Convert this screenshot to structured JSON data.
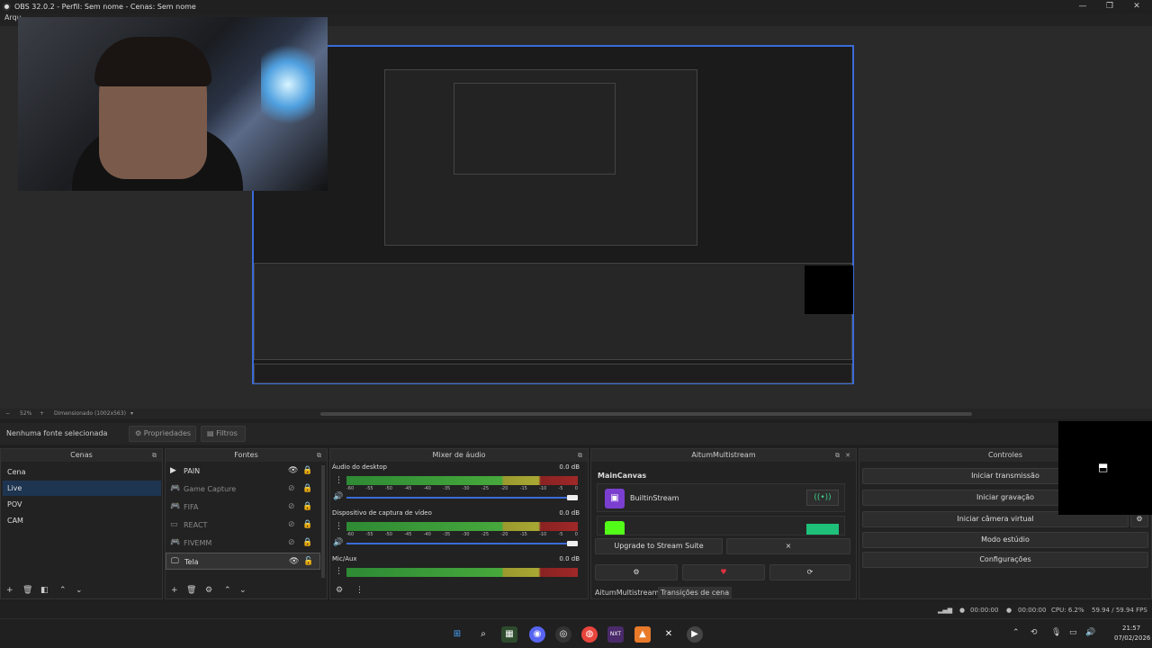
{
  "window": {
    "title": "OBS 32.0.2 - Perfil: Sem nome - Cenas: Sem nome",
    "menu_partial": "Arqu"
  },
  "zoom": {
    "minus": "−",
    "level": "52%",
    "plus": "+",
    "mode": "Dimensionado (1002x563)"
  },
  "source_toolbar": {
    "none_selected": "Nenhuma fonte selecionada",
    "properties": "Propriedades",
    "filters": "Filtros"
  },
  "scenes": {
    "title": "Cenas",
    "items": [
      "Cena",
      "Live",
      "POV",
      "CAM"
    ],
    "selected": 1
  },
  "sources": {
    "title": "Fontes",
    "items": [
      {
        "name": "PAIN",
        "icon": "play-icon",
        "visible": true
      },
      {
        "name": "Game Capture",
        "icon": "gamepad-icon",
        "visible": false
      },
      {
        "name": "FIFA",
        "icon": "gamepad-icon",
        "visible": false
      },
      {
        "name": "REACT",
        "icon": "window-icon",
        "visible": false
      },
      {
        "name": "FIVEMM",
        "icon": "gamepad-icon",
        "visible": false
      },
      {
        "name": "Tela",
        "icon": "monitor-icon",
        "visible": true
      }
    ]
  },
  "mixer": {
    "title": "Mixer de áudio",
    "channels": [
      {
        "name": "Áudio do desktop",
        "db": "0.0 dB"
      },
      {
        "name": "Dispositivo de captura de vídeo",
        "db": "0.0 dB"
      },
      {
        "name": "Mic/Aux",
        "db": "0.0 dB"
      }
    ],
    "ticks": [
      "-60",
      "-55",
      "-50",
      "-45",
      "-40",
      "-35",
      "-30",
      "-25",
      "-20",
      "-15",
      "-10",
      "-5",
      "0"
    ]
  },
  "multistream": {
    "title": "AitumMultistream",
    "canvas": "MainCanvas",
    "stream": "BuiltinStream",
    "upgrade": "Upgrade to Stream Suite",
    "close": "×",
    "tabs": [
      "AitumMultistream",
      "Transições de cena"
    ]
  },
  "controls": {
    "title": "Controles",
    "buttons": [
      "Iniciar transmissão",
      "Iniciar gravação",
      "Iniciar câmera virtual",
      "Modo estúdio",
      "Configurações"
    ]
  },
  "status": {
    "stream_time": "00:00:00",
    "rec_time": "00:00:00",
    "cpu": "CPU: 6.2%",
    "fps": "59.94 / 59.94 FPS"
  },
  "taskbar": {
    "time": "21:57",
    "date": "07/02/2026"
  }
}
